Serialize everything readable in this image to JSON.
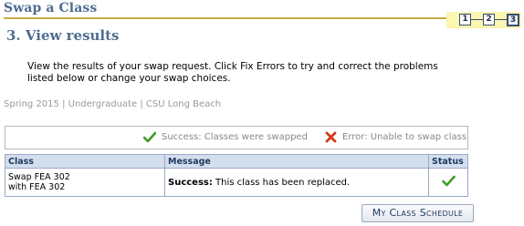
{
  "page": {
    "title": "Swap a Class",
    "step_heading": "3.  View results",
    "instructions": "View the results of your swap request.  Click Fix Errors to try and correct the problems listed below or change your swap choices.",
    "term_info": "Spring 2015 | Undergraduate | CSU Long Beach"
  },
  "steps": {
    "items": [
      "1",
      "2",
      "3"
    ],
    "active": "3"
  },
  "legend": {
    "success_label": "Success: Classes were swapped",
    "error_label": "Error: Unable to swap class"
  },
  "results_table": {
    "headers": {
      "class": "Class",
      "message": "Message",
      "status": "Status"
    },
    "rows": [
      {
        "class_line1": "Swap FEA  302",
        "class_line2": "with FEA  302",
        "message_strong": "Success:",
        "message_text": " This class has been replaced.",
        "status": "success"
      }
    ]
  },
  "buttons": {
    "my_class_schedule": "My Class Schedule"
  },
  "colors": {
    "heading": "#4f6d8f",
    "rule": "#c7ad48",
    "step_bg": "#fbf6b0",
    "table_header_bg": "#d3dfee",
    "success_green": "#3e9d22",
    "error_red": "#d23a1c"
  }
}
